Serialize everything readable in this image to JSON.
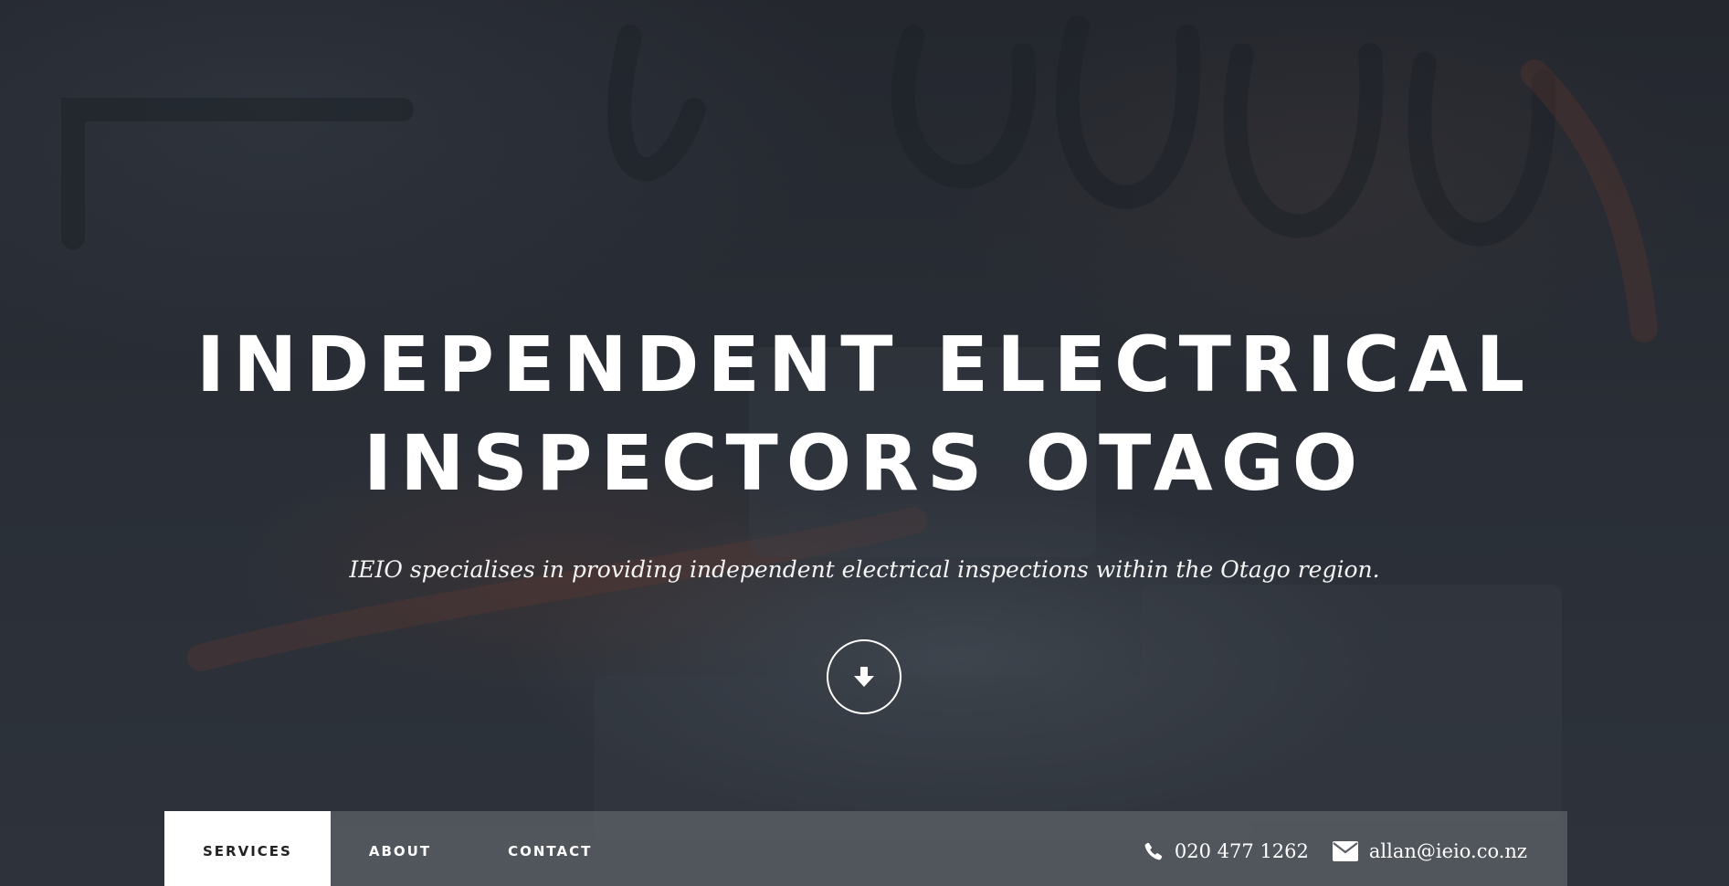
{
  "hero": {
    "title_line1": "INDEPENDENT ELECTRICAL",
    "title_line2": "INSPECTORS OTAGO",
    "subtitle": "IEIO specialises in providing independent electrical inspections within the Otago region.",
    "scroll_icon": "arrow-down-icon"
  },
  "nav": {
    "items": [
      {
        "label": "SERVICES",
        "active": true
      },
      {
        "label": "ABOUT",
        "active": false
      },
      {
        "label": "CONTACT",
        "active": false
      }
    ],
    "phone": {
      "icon": "phone-icon",
      "text": "020 477 1262"
    },
    "email": {
      "icon": "envelope-icon",
      "text": "allan@ieio.co.nz"
    }
  },
  "colors": {
    "overlay": "#262a31",
    "text": "#ffffff",
    "active_tab_bg": "#ffffff",
    "active_tab_text": "#222222"
  }
}
